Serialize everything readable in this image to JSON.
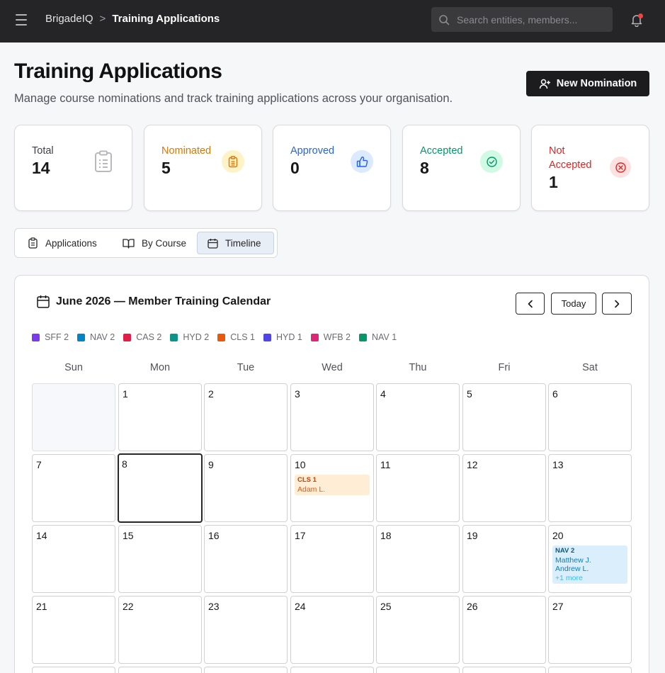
{
  "topbar": {
    "breadcrumb_root": "BrigadeIQ",
    "breadcrumb_sep": ">",
    "breadcrumb_current": "Training Applications",
    "search_placeholder": "Search entities, members..."
  },
  "header": {
    "title": "Training Applications",
    "subtitle": "Manage course nominations and track training applications across your organisation.",
    "new_button": "New Nomination"
  },
  "stats": {
    "total": {
      "label": "Total",
      "value": "14",
      "color": "#3f3f46"
    },
    "nominated": {
      "label": "Nominated",
      "value": "5",
      "color": "#d97706"
    },
    "approved": {
      "label": "Approved",
      "value": "0",
      "color": "#2563eb"
    },
    "accepted": {
      "label": "Accepted",
      "value": "8",
      "color": "#059669"
    },
    "not_accepted": {
      "label_line1": "Not",
      "label_line2": "Accepted",
      "value": "1",
      "color": "#dc2626"
    }
  },
  "tabs": {
    "applications": "Applications",
    "by_course": "By Course",
    "timeline": "Timeline",
    "active": "timeline"
  },
  "calendar": {
    "title": "June 2026 — Member Training Calendar",
    "today_label": "Today",
    "legend": [
      {
        "label": "SFF 2",
        "color": "#7c3aed"
      },
      {
        "label": "NAV 2",
        "color": "#0284c7"
      },
      {
        "label": "CAS 2",
        "color": "#e11d48"
      },
      {
        "label": "HYD 2",
        "color": "#0d9488"
      },
      {
        "label": "CLS 1",
        "color": "#ea580c"
      },
      {
        "label": "HYD 1",
        "color": "#4f46e5"
      },
      {
        "label": "WFB 2",
        "color": "#db2777"
      },
      {
        "label": "NAV 1",
        "color": "#059669"
      }
    ],
    "weekdays": [
      "Sun",
      "Mon",
      "Tue",
      "Wed",
      "Thu",
      "Fri",
      "Sat"
    ],
    "days": [
      "1",
      "2",
      "3",
      "4",
      "5",
      "6",
      "7",
      "8",
      "9",
      "10",
      "11",
      "12",
      "13",
      "14",
      "15",
      "16",
      "17",
      "18",
      "19",
      "20",
      "21",
      "22",
      "23",
      "24",
      "25",
      "26",
      "27"
    ],
    "events": {
      "cls1": {
        "code": "CLS 1",
        "line1": "Adam L."
      },
      "nav2": {
        "code": "NAV 2",
        "line1": "Matthew J.",
        "line2": "Andrew L.",
        "more": "+1 more"
      }
    }
  }
}
